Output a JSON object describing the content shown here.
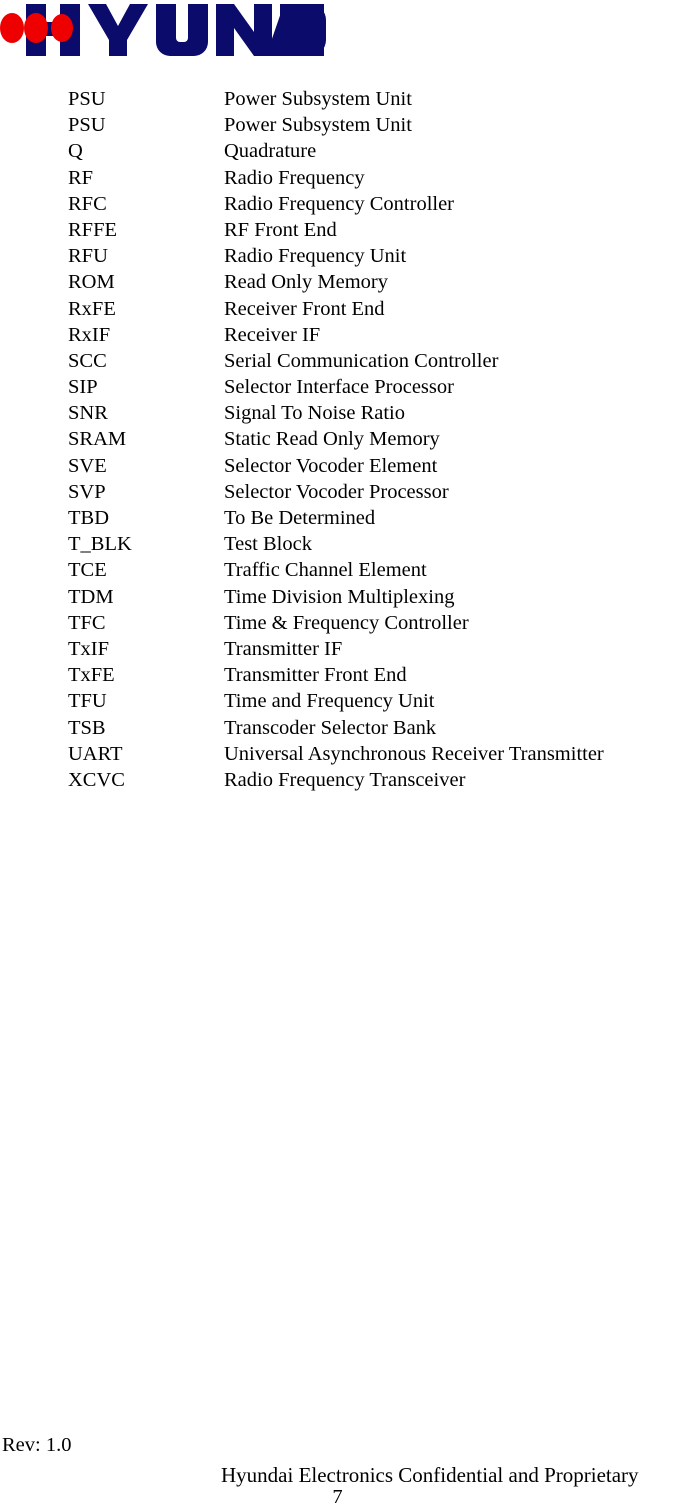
{
  "document": {
    "logo": {
      "brand_name": "HYUNDAI",
      "wordmark_color": "#0b0b6b",
      "accent_color": "#ee0000"
    },
    "abbreviations": {
      "term_header": "",
      "definition_header": "",
      "rows": [
        {
          "term": "PSU",
          "definition": "Power Subsystem Unit"
        },
        {
          "term": "PSU",
          "definition": "Power Subsystem Unit"
        },
        {
          "term": "Q",
          "definition": "Quadrature"
        },
        {
          "term": "RF",
          "definition": "Radio Frequency"
        },
        {
          "term": "RFC",
          "definition": "Radio Frequency Controller"
        },
        {
          "term": "RFFE",
          "definition": "RF Front End"
        },
        {
          "term": "RFU",
          "definition": "Radio Frequency Unit"
        },
        {
          "term": "ROM",
          "definition": "Read Only Memory"
        },
        {
          "term": "RxFE",
          "definition": "Receiver Front End"
        },
        {
          "term": "RxIF",
          "definition": "Receiver IF"
        },
        {
          "term": "SCC",
          "definition": "Serial Communication Controller"
        },
        {
          "term": "SIP",
          "definition": "Selector Interface Processor"
        },
        {
          "term": "SNR",
          "definition": "Signal To Noise Ratio"
        },
        {
          "term": "SRAM",
          "definition": "Static Read Only Memory"
        },
        {
          "term": "SVE",
          "definition": "Selector Vocoder Element"
        },
        {
          "term": "SVP",
          "definition": "Selector Vocoder Processor"
        },
        {
          "term": "TBD",
          "definition": "To Be Determined"
        },
        {
          "term": "T_BLK",
          "definition": "Test Block"
        },
        {
          "term": "TCE",
          "definition": "Traffic Channel Element"
        },
        {
          "term": "TDM",
          "definition": "Time Division Multiplexing"
        },
        {
          "term": "TFC",
          "definition": "Time & Frequency Controller"
        },
        {
          "term": "TxIF",
          "definition": "Transmitter IF"
        },
        {
          "term": "TxFE",
          "definition": "Transmitter Front End"
        },
        {
          "term": "TFU",
          "definition": "Time and Frequency Unit"
        },
        {
          "term": "TSB",
          "definition": "Transcoder Selector Bank"
        },
        {
          "term": "UART",
          "definition": "Universal Asynchronous Receiver  Transmitter"
        },
        {
          "term": "XCVC",
          "definition": "Radio Frequency Transceiver"
        }
      ]
    },
    "footer": {
      "revision": "Rev: 1.0",
      "confidentiality": "Hyundai Electronics Confidential and Proprietary",
      "page_number": "7"
    }
  }
}
